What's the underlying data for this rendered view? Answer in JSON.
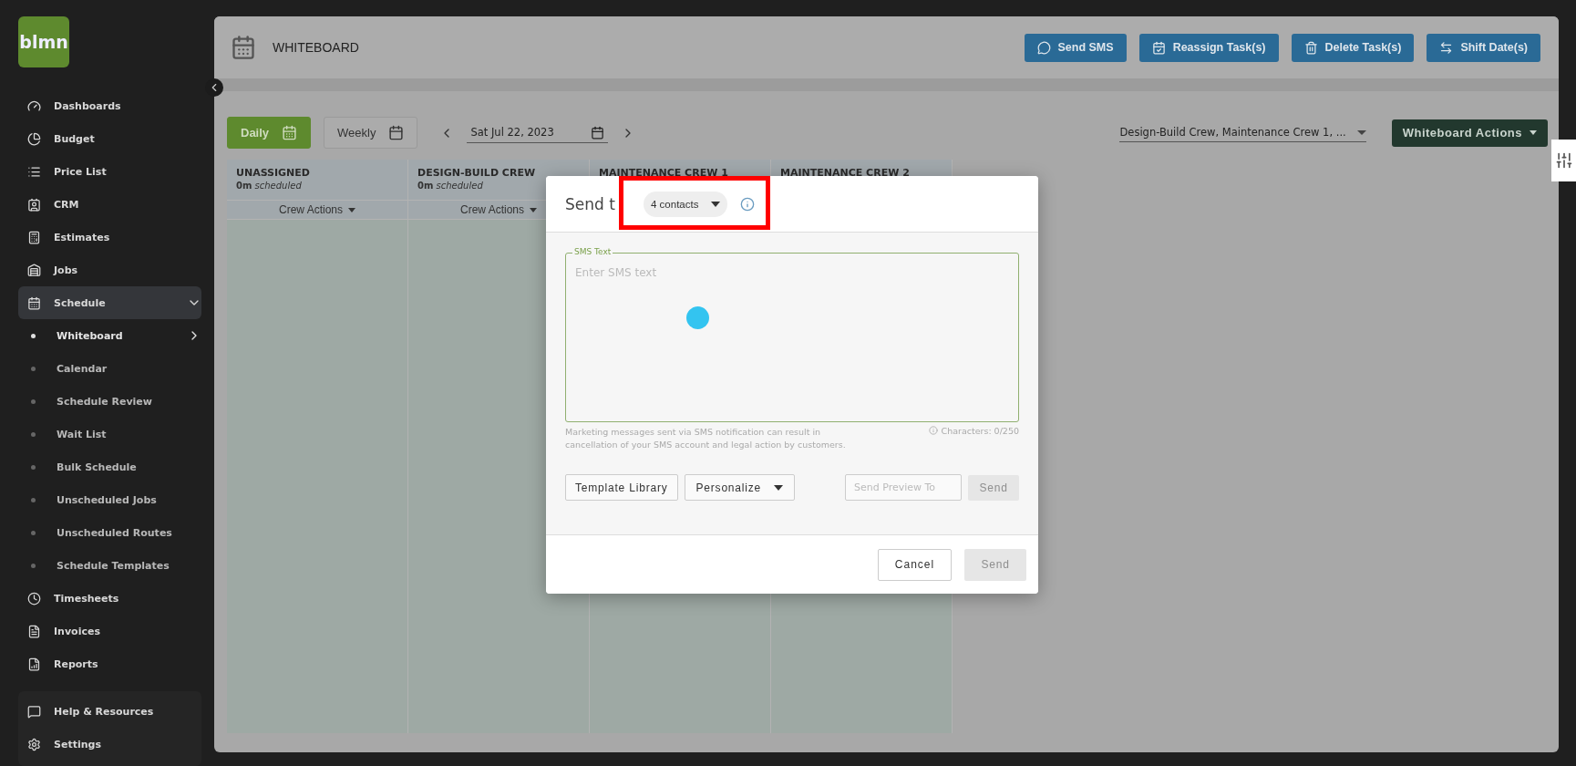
{
  "sidebar": {
    "logo": "blmn",
    "items": [
      {
        "label": "Dashboards",
        "selected": false
      },
      {
        "label": "Budget",
        "selected": false
      },
      {
        "label": "Price List",
        "selected": false
      },
      {
        "label": "CRM",
        "selected": false
      },
      {
        "label": "Estimates",
        "selected": false
      },
      {
        "label": "Jobs",
        "selected": false
      },
      {
        "label": "Schedule",
        "selected": true,
        "expanded": true,
        "children": [
          {
            "label": "Whiteboard",
            "selected": true
          },
          {
            "label": "Calendar",
            "selected": false
          },
          {
            "label": "Schedule Review",
            "selected": false
          },
          {
            "label": "Wait List",
            "selected": false
          },
          {
            "label": "Bulk Schedule",
            "selected": false
          },
          {
            "label": "Unscheduled Jobs",
            "selected": false
          },
          {
            "label": "Unscheduled Routes",
            "selected": false
          },
          {
            "label": "Schedule Templates",
            "selected": false
          }
        ]
      },
      {
        "label": "Timesheets",
        "selected": false
      },
      {
        "label": "Invoices",
        "selected": false
      },
      {
        "label": "Reports",
        "selected": false
      }
    ],
    "footer_items": [
      {
        "label": "Help & Resources"
      },
      {
        "label": "Settings"
      }
    ]
  },
  "header": {
    "title": "WHITEBOARD",
    "actions": [
      "Send SMS",
      "Reassign Task(s)",
      "Delete Task(s)",
      "Shift Date(s)"
    ]
  },
  "toolbar": {
    "view_tabs": [
      {
        "label": "Daily",
        "selected": true
      },
      {
        "label": "Weekly",
        "selected": false
      }
    ],
    "date": "Sat Jul 22, 2023",
    "crew_filter": "Design-Build Crew, Maintenance Crew 1, ...",
    "actions_button": "Whiteboard Actions"
  },
  "columns": [
    {
      "title": "UNASSIGNED",
      "duration": "0m",
      "status": "scheduled",
      "action": "Crew Actions"
    },
    {
      "title": "DESIGN-BUILD CREW",
      "duration": "0m",
      "status": "scheduled",
      "action": "Crew Actions"
    },
    {
      "title": "MAINTENANCE CREW 1"
    },
    {
      "title": "MAINTENANCE CREW 2"
    }
  ],
  "modal": {
    "title": "Send t",
    "recipients": "4 contacts",
    "recipients_highlighted": true,
    "field_label": "SMS Text",
    "placeholder": "Enter SMS text",
    "disclaimer": "Marketing messages sent via SMS notification can result in cancellation of your SMS account and legal action by customers.",
    "char_count": "Characters: 0/250",
    "template_button": "Template Library",
    "personalize_button": "Personalize",
    "preview_placeholder": "Send Preview To",
    "preview_send": {
      "label": "Send",
      "disabled": true
    },
    "cancel": "Cancel",
    "send": {
      "label": "Send",
      "disabled": true
    }
  }
}
